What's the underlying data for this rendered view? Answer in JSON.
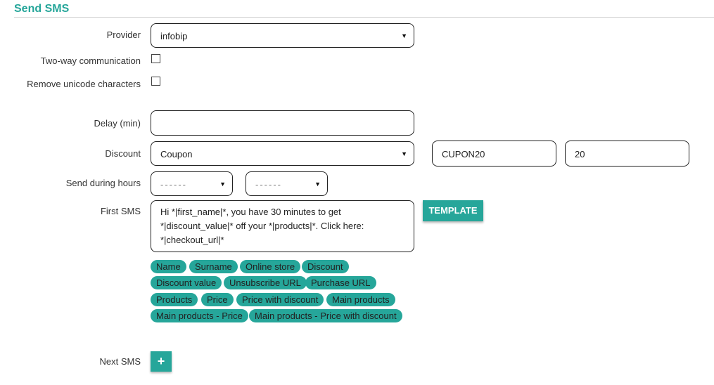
{
  "header": {
    "title": "Send SMS"
  },
  "form": {
    "provider_label": "Provider",
    "provider_value": "infobip",
    "two_way_label": "Two-way communication",
    "remove_unicode_label": "Remove unicode characters",
    "delay_label": "Delay (min)",
    "delay_value": "",
    "discount_label": "Discount",
    "discount_type": "Coupon",
    "coupon_code": "CUPON20",
    "discount_amount": "20",
    "hours_label": "Send during hours",
    "hours_from": "------",
    "hours_to": "------",
    "first_sms_label": "First SMS",
    "first_sms_text": "Hi *|first_name|*, you have 30 minutes to get *|discount_value|* off your *|products|*. Click here: *|checkout_url|*",
    "template_button": "TEMPLATE",
    "next_sms_label": "Next SMS",
    "add_button": "+"
  },
  "tags": [
    "Name",
    "Surname",
    "Online store",
    "Discount",
    "Discount value",
    "Unsubscribe URL",
    "Purchase URL",
    "Products",
    "Price",
    "Price with discount",
    "Main products",
    "Main products - Price",
    "Main products - Price with discount"
  ],
  "colors": {
    "accent": "#26a69a"
  },
  "icons": {
    "dropdown": "caret-down-icon",
    "add": "plus-icon"
  }
}
